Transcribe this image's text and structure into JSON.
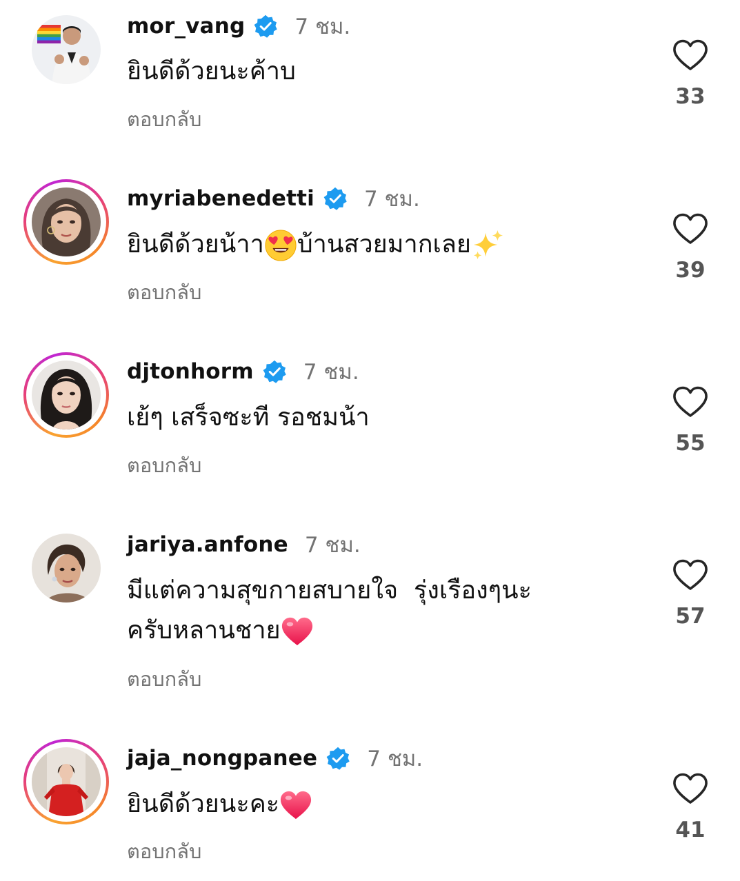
{
  "comments": [
    {
      "username": "mor_vang",
      "verified": true,
      "time": "7 ชม.",
      "text": "ยินดีด้วยนะค้าบ",
      "emoji_after": "",
      "text_tail": "",
      "text_line2": "",
      "emoji_end": "",
      "reply": "ตอบกลับ",
      "likes": "33",
      "avatar_icon": "rainbow-flag-person-avatar"
    },
    {
      "username": "myriabenedetti",
      "verified": true,
      "time": "7 ชม.",
      "text": "ยินดีด้วยน้าา",
      "emoji_after": "heart-eyes-emoji",
      "text_tail": "บ้านสวยมากเลย",
      "text_line2": "",
      "emoji_end": "sparkles-emoji",
      "reply": "ตอบกลับ",
      "likes": "39",
      "avatar_icon": "woman-portrait-avatar"
    },
    {
      "username": "djtonhorm",
      "verified": true,
      "time": "7 ชม.",
      "text": "เย้ๆ เสร็จซะที รอชมน้า",
      "emoji_after": "",
      "text_tail": "",
      "text_line2": "",
      "emoji_end": "",
      "reply": "ตอบกลับ",
      "likes": "55",
      "avatar_icon": "woman-portrait-avatar"
    },
    {
      "username": "jariya.anfone",
      "verified": false,
      "time": "7 ชม.",
      "text": "มีแต่ความสุขกายสบายใจ  รุ่งเรืองๆนะ",
      "emoji_after": "",
      "text_tail": "",
      "text_line2": "ครับหลานชาย",
      "emoji_end": "red-heart-emoji",
      "reply": "ตอบกลับ",
      "likes": "57",
      "avatar_icon": "woman-portrait-avatar"
    },
    {
      "username": "jaja_nongpanee",
      "verified": true,
      "time": "7 ชม.",
      "text": "ยินดีด้วยนะคะ",
      "emoji_after": "",
      "text_tail": "",
      "text_line2": "",
      "emoji_end": "red-heart-emoji",
      "reply": "ตอบกลับ",
      "likes": "41",
      "avatar_icon": "woman-red-dress-avatar"
    }
  ],
  "colors": {
    "verified_blue": "#1d9bf0",
    "secondary_text": "#737373",
    "story_ring": [
      "#f9a230",
      "#e63f7b",
      "#c026d3"
    ]
  },
  "icons": {
    "like": "heart-outline-icon",
    "verified": "verified-badge-icon"
  }
}
